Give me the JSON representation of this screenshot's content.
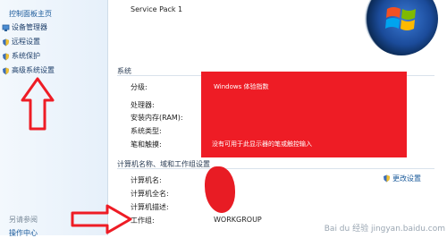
{
  "sidebar": {
    "home": "控制面板主页",
    "items": [
      {
        "label": "设备管理器",
        "icon": "device-manager-icon"
      },
      {
        "label": "远程设置",
        "icon": "shield-icon"
      },
      {
        "label": "系统保护",
        "icon": "shield-icon"
      },
      {
        "label": "高级系统设置",
        "icon": "shield-icon"
      }
    ],
    "see_also": "另请参阅",
    "see_also_item": "操作中心"
  },
  "edition": {
    "service_pack": "Service Pack 1"
  },
  "system": {
    "header": "系统",
    "rating_label": "分级:",
    "rating_value": "Windows 体验指数",
    "processor_label": "处理器:",
    "processor_value": "",
    "ram_label": "安装内存(RAM):",
    "ram_value": "",
    "type_label": "系统类型:",
    "type_value": "",
    "pen_label": "笔和触摸:",
    "pen_value": "没有可用于此显示器的笔或触控输入"
  },
  "computer": {
    "header": "计算机名称、域和工作组设置",
    "name_label": "计算机名:",
    "fullname_label": "计算机全名:",
    "desc_label": "计算机描述:",
    "workgroup_label": "工作组:",
    "workgroup_value": "WORKGROUP",
    "change_link": "更改设置"
  },
  "colors": {
    "redaction": "#ee1c25",
    "annotation_arrow": "#ee1c25",
    "link": "#1a5a9a"
  },
  "watermark": "Bai du 经验  jingyan.baidu.com"
}
